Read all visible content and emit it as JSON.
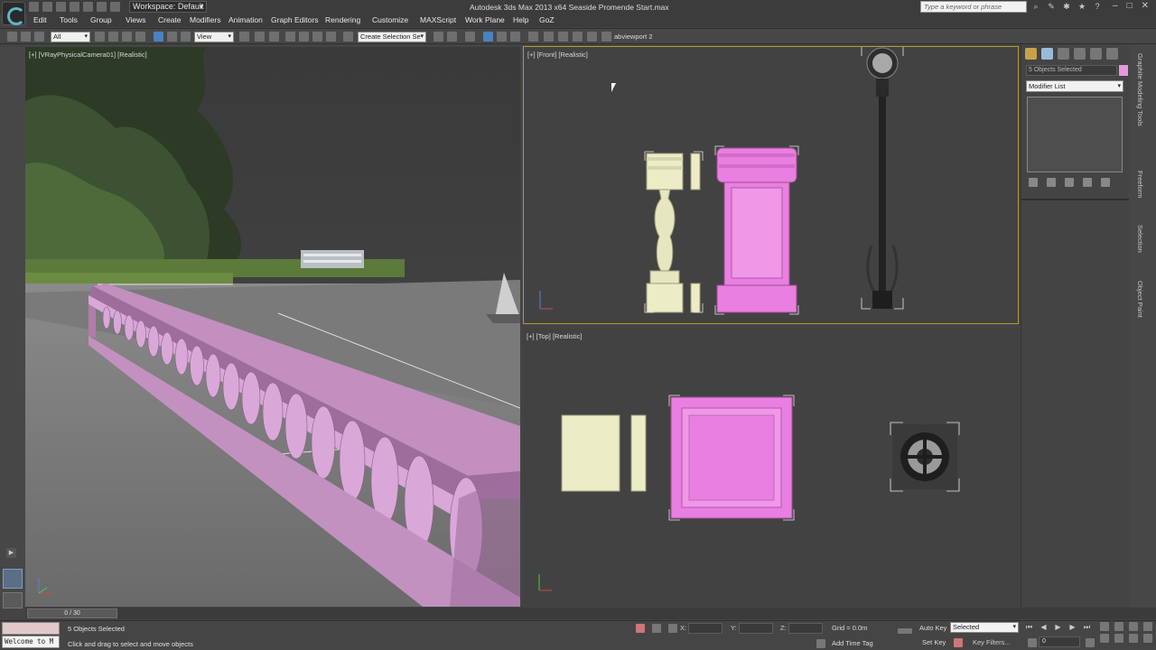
{
  "title_bar": {
    "workspace_label": "Workspace: Default",
    "app_title": "Autodesk 3ds Max  2013 x64      Seaside Promende Start.max",
    "search_placeholder": "Type a keyword or phrase"
  },
  "menu": {
    "items": [
      "Edit",
      "Tools",
      "Group",
      "Views",
      "Create",
      "Modifiers",
      "Animation",
      "Graph Editors",
      "Rendering",
      "Customize",
      "MAXScript",
      "Work Plane",
      "Help",
      "GoZ"
    ]
  },
  "toolbar": {
    "selection_filter": "All",
    "reference_coord": "View",
    "named_selection": "Create Selection Se",
    "viewport_label": "abviewport 2"
  },
  "viewports": {
    "perspective_label": "[+] [VRayPhysicalCamera01] [Realistic]",
    "front_label": "[+] [Front] [Realistic]",
    "top_label": "[+] [Top] [Realistic]"
  },
  "command_panel": {
    "selection_name": "5 Objects Selected",
    "modifier_list": "Modifier List",
    "selection_color": "#e896e0"
  },
  "ribbon_tabs": [
    "Graphite Modeling Tools",
    "Freeform",
    "Selection",
    "Object Paint"
  ],
  "status": {
    "time_slider": "0 / 30",
    "objects_selected": "5 Objects Selected",
    "prompt": "Click and drag to select and move objects",
    "maxscript_text": "Welcome to M",
    "x_label": "X:",
    "y_label": "Y:",
    "z_label": "Z:",
    "grid": "Grid = 0.0m",
    "add_time_tag": "Add Time Tag",
    "auto_key": "Auto Key",
    "set_key": "Set Key",
    "key_mode": "Selected",
    "key_filters": "Key Filters...",
    "frame": "0"
  },
  "colors": {
    "railing_pink": "#d9a8d8",
    "pedestal_pink": "#e97fe0",
    "baluster_cream": "#ecedc6",
    "active_border": "#b39a3c"
  }
}
